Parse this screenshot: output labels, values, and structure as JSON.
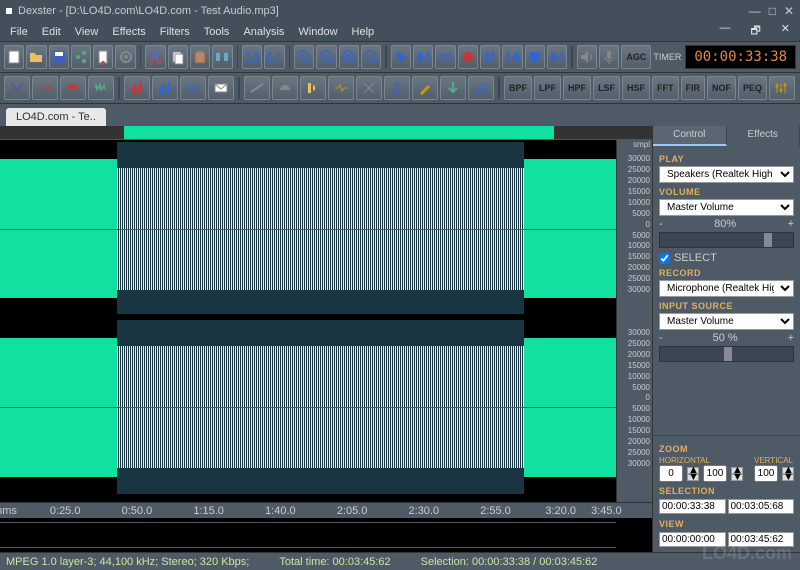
{
  "app": {
    "title": "Dexster - [D:\\LO4D.com\\LO4D.com - Test Audio.mp3]"
  },
  "menu": {
    "items": [
      "File",
      "Edit",
      "View",
      "Effects",
      "Filters",
      "Tools",
      "Analysis",
      "Window",
      "Help"
    ]
  },
  "toolbar1": {
    "timer_label": "TIMER",
    "timer_value": "00:00:33:38",
    "buttons": [
      "new",
      "open",
      "save",
      "share",
      "paste",
      "settings",
      "cut",
      "copy",
      "clipboard",
      "trim",
      "undo",
      "redo",
      "zoom-in",
      "zoom-out",
      "zoom-sel",
      "zoom-fit",
      "play",
      "pause",
      "loop",
      "record",
      "stop",
      "skip-back",
      "skip-fwd",
      "end",
      "speaker",
      "mic"
    ],
    "agc": "AGC"
  },
  "toolbar2": {
    "buttons": [
      "fx1",
      "fx2",
      "fx3",
      "fx4",
      "fx5",
      "fx6",
      "fx7",
      "fx8",
      "mail",
      "fx9",
      "fx10",
      "fx11",
      "fx12",
      "fx13",
      "fx14",
      "fx15",
      "note"
    ],
    "filters": [
      "BPF",
      "LPF",
      "HPF",
      "LSF",
      "HSF",
      "FFT",
      "FIR",
      "NOF",
      "PEQ"
    ],
    "eq": "eq"
  },
  "tabs": {
    "file": "LO4D.com - Te.."
  },
  "yaxis": {
    "smpl": "smpl",
    "ticks_top": [
      "30000",
      "25000",
      "20000",
      "15000",
      "10000",
      "5000",
      "0",
      "5000",
      "10000",
      "15000",
      "20000",
      "25000",
      "30000"
    ],
    "ticks_bot": [
      "30000",
      "25000",
      "20000",
      "15000",
      "10000",
      "5000",
      "0",
      "5000",
      "10000",
      "15000",
      "20000",
      "25000",
      "30000"
    ]
  },
  "xaxis": {
    "hms": "hms",
    "ticks": [
      "0:25.0",
      "0:50.0",
      "1:15.0",
      "1:40.0",
      "2:05.0",
      "2:30.0",
      "2:55.0",
      "3:20.0",
      "3:45.0"
    ]
  },
  "side": {
    "tab_control": "Control",
    "tab_effects": "Effects",
    "play": "PLAY",
    "play_device": "Speakers (Realtek High Def",
    "volume": "VOLUME",
    "volume_device": "Master Volume",
    "volume_pct": "80%",
    "select": "SELECT",
    "record": "RECORD",
    "record_device": "Microphone (Realtek High D",
    "input_source": "INPUT SOURCE",
    "input_device": "Master Volume",
    "input_pct": "50 %",
    "zoom": "ZOOM",
    "horizontal": "HORIZONTAL",
    "vertical": "VERTICAL",
    "zoom_h_a": "0",
    "zoom_h_b": "100",
    "zoom_v": "100",
    "selection": "SELECTION",
    "sel_start": "00:00:33:38",
    "sel_end": "00:03:05:68",
    "view": "VIEW",
    "view_start": "00:00:00:00",
    "view_end": "00:03:45:62"
  },
  "status": {
    "format": "MPEG 1.0 layer-3; 44,100 kHz; Stereo; 320 Kbps;",
    "total": "Total time: 00:03:45:62",
    "selection": "Selection: 00:00:33:38 / 00:03:45:62"
  },
  "watermark": "LO4D.com"
}
